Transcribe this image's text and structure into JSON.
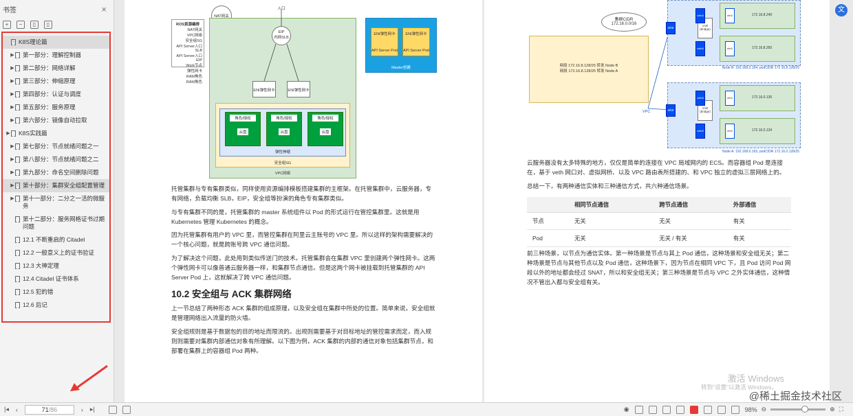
{
  "sidebar": {
    "title": "书签",
    "close": "×",
    "items": [
      {
        "label": "K8S理论篇",
        "level": 0,
        "arrow": false,
        "selected": true
      },
      {
        "label": "第一部分：理解控制器",
        "level": 1,
        "arrow": true
      },
      {
        "label": "第二部分：网络详解",
        "level": 1,
        "arrow": true
      },
      {
        "label": "第三部分：伸缩原理",
        "level": 1,
        "arrow": true
      },
      {
        "label": "第四部分：认证与调度",
        "level": 1,
        "arrow": true
      },
      {
        "label": "第五部分：服务原理",
        "level": 1,
        "arrow": true
      },
      {
        "label": "第六部分：镜像自动拉取",
        "level": 1,
        "arrow": true
      },
      {
        "label": "K8S实践篇",
        "level": 0,
        "arrow": true
      },
      {
        "label": "第七部分：节点就绪问题之一",
        "level": 1,
        "arrow": true
      },
      {
        "label": "第八部分：节点就绪问题之二",
        "level": 1,
        "arrow": true
      },
      {
        "label": "第九部分：命名空间删除问题",
        "level": 1,
        "arrow": true
      },
      {
        "label": "第十部分：集群安全组配置管理",
        "level": 1,
        "arrow": true,
        "selected": true
      },
      {
        "label": "第十一部分：二分之一活的微服务",
        "level": 1,
        "arrow": true
      },
      {
        "label": "第十二部分：服务网格证书过期问题",
        "level": 1,
        "arrow": false
      },
      {
        "label": "12.1 不断重启的 Citadel",
        "level": 2
      },
      {
        "label": "12.2 一般意义上的证书验证",
        "level": 2
      },
      {
        "label": "12.3 大神定理",
        "level": 2
      },
      {
        "label": "12.4 Citadel 证书体系",
        "level": 2
      },
      {
        "label": "12.5 犯的错",
        "level": 2
      },
      {
        "label": "12.6 后记",
        "level": 2
      }
    ]
  },
  "left_page": {
    "diagram": {
      "nat": "NAT网关",
      "entry": "入口",
      "eip": "EIP",
      "slb": "内网SLB",
      "ros_title": "ROS资源编排",
      "ros_lines": [
        "NAT网关",
        "VPC网络",
        "安全组SG",
        "API Server入口SLB",
        "API Server入口EIP",
        "Work节点",
        "弹性网卡",
        "RAM角色",
        "RAM角色"
      ],
      "eni_l": "ENI弹性网卡",
      "eni_r": "ENI弹性网卡",
      "master_eni_1": "ENI弹性网卡",
      "master_eni_2": "ENI弹性网卡",
      "api_1": "API Server Pod",
      "api_2": "API Server Pod",
      "master_label": "Master创建",
      "role": "角色/授权",
      "disk": "云盘",
      "eni_band": "弹性伸缩",
      "sg": "安全组SG",
      "vpc": "VPC网络"
    },
    "p1": "托管集群与专有集群类似，同样使用资源编排模板搭建集群的主框架。在托管集群中，云服务器，专有网络，负载均衡 SLB，EIP，安全组等扮演的角色专有集群类似。",
    "p2": "与专有集群不同的是，托管集群的 master 系统组件以 Pod 的形式运行在管控集群里。这就是用 Kubernetes 管理 Kubernetes 的概念。",
    "p3": "因为托管集群有用户的 VPC 里，而管控集群在阿里云主账号的 VPC 里。所以这样的架构需要解决的一个核心问题，就是跨账号跨 VPC 通信问题。",
    "p4": "为了解决这个问题，此处用到类似传送门的技术。托管集群会在集群 VPC 里创建两个弹性网卡。这两个弹性网卡可以像普通云服务器一样，和集群节点通信。但是这两个网卡被挂载到托管集群的 API Server Pod 上，这就解决了跨 VPC 通信问题。",
    "h2": "10.2 安全组与 ACK 集群网络",
    "p5": "上一节总结了两种形态 ACK 集群的组成原理，以及安全组在集群中所处的位置。简单来说，安全组就是管理网络出入流量的防火墙。",
    "p6": "安全组规则是基于数据包的目的地址而限流的。出规则需要基于对目标地址的管控需求而定，而入规则则需要对集群内部通信对象有所理解。以下图为例，ACK 集群的内部的通信对象包括集群节点，和部署在集群上的容器组 Pod 两种。"
  },
  "right_page": {
    "diagram": {
      "cloud": "集群CIDR",
      "cloud_val": "172.16.0.0/16",
      "route1": "网段 172.16.8.128/25 转发 Node B",
      "route2": "网段 172.16.8.128/25 转发 Node A",
      "vpc": "VPC",
      "eth0": "eth0",
      "veth": "veth0",
      "cni": "cni0",
      "bridge": "(bridge)",
      "ip1": "172.16.8.249",
      "ip2": "172.16.8.250",
      "ip3": "172.16.0.135",
      "ip4": "172.16.0.134",
      "nodeB": "Node B: 192.168.0.194, podCIDR 172.16.8.128/25",
      "nodeA": "Node A: 192.168.0.193, podCIDR 172.16.0.128/25"
    },
    "p1": "云服务器没有太多特殊的地方，仅仅是简单的连接在 VPC 局域网内的 ECS。而容器组 Pod 是连接在，基于 veth 网口对、虚拟网桥、以及 VPC 路由表所搭建的、和 VPC 独立的虚拟三层网络上的。",
    "p2": "总结一下，有两种通信实体和三种通信方式，共六种通信场景。",
    "table": {
      "headers": [
        "",
        "相同节点通信",
        "跨节点通信",
        "外部通信"
      ],
      "rows": [
        [
          "节点",
          "无关",
          "无关",
          "有关"
        ],
        [
          "Pod",
          "无关",
          "无关 / 有关",
          "有关"
        ]
      ]
    },
    "p3": "前三种场景，以节点为通信实体。第一种场景是节点与其上 Pod 通信，这种场景和安全组无关；第二种场景是节点与其他节点以及 Pod 通信，这种场景下，因为节点在相同 VPC 下，且 Pod 访问 Pod 网段以外的地址都会经过 SNAT，所以和安全组无关；第三种场景是节点与 VPC 之外实体通信，这种情况不管出入都与安全组有关。"
  },
  "watermark": {
    "line1": "激活 Windows",
    "line2": "转到\"设置\"以激活 Windows。",
    "brand": "@稀土掘金技术社区"
  },
  "bottombar": {
    "page_current": "71",
    "page_total": "/86",
    "zoom": "98%",
    "zoom_fraction": 0.62
  },
  "colors": {
    "accent_red": "#e53935",
    "vpc_green": "#d5e8d4",
    "sg_yellow": "#fff2cc",
    "master_blue": "#1ba1e2",
    "node_green": "#00a03e"
  }
}
